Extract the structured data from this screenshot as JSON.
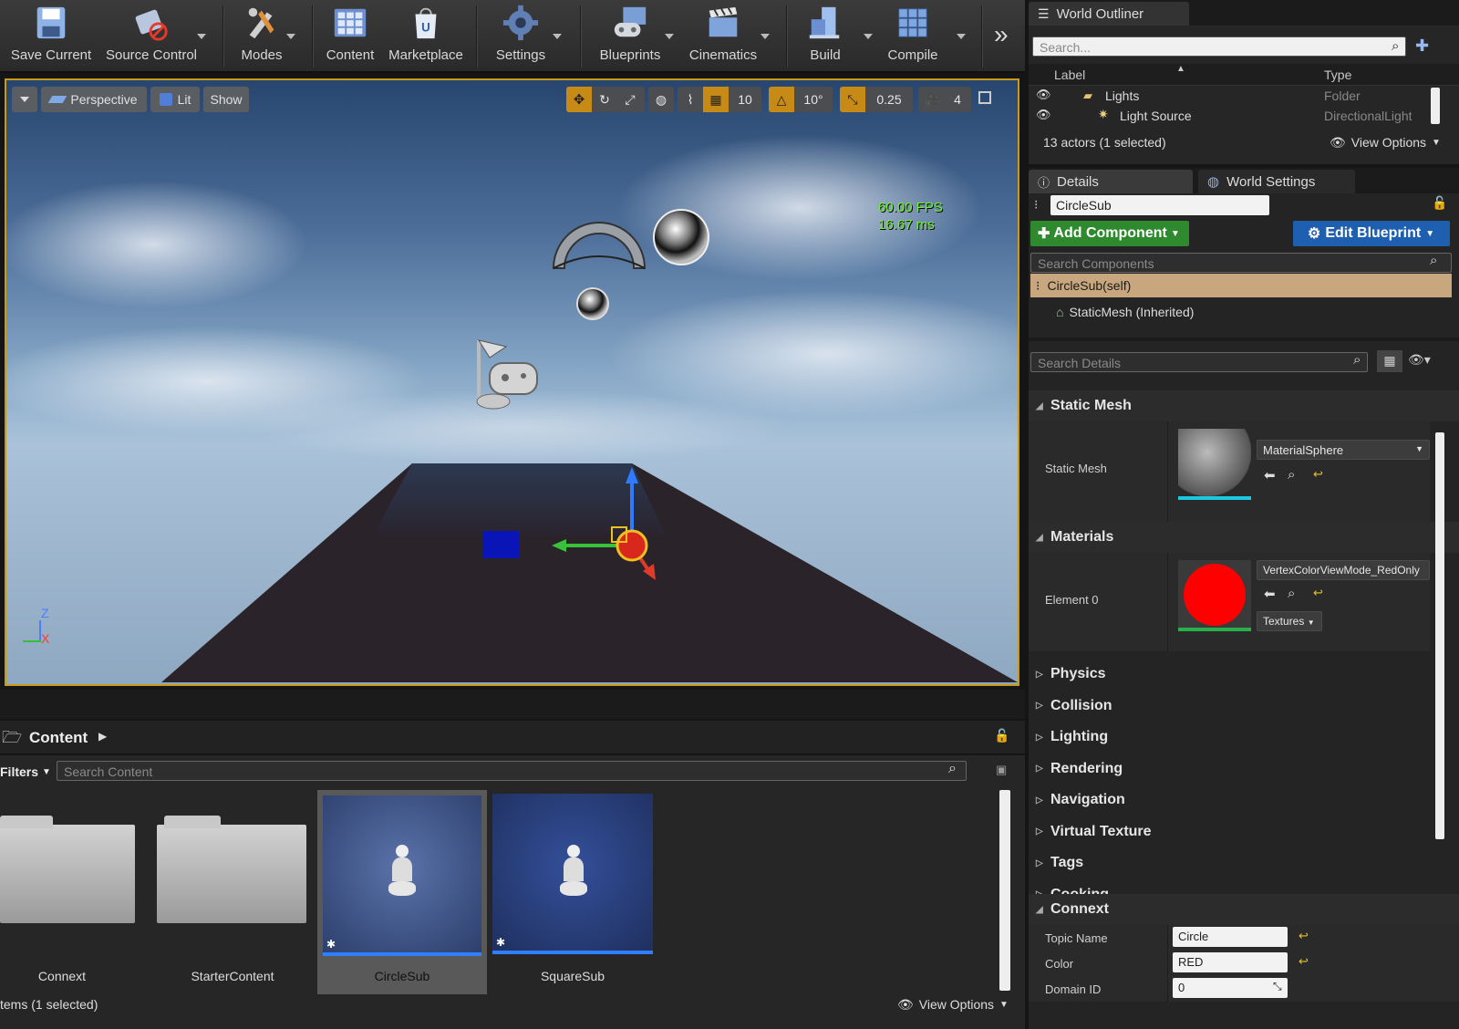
{
  "toolbar": {
    "items": [
      {
        "label": "Save Current",
        "icon": "save-icon"
      },
      {
        "label": "Source Control",
        "icon": "source-control-icon"
      },
      {
        "label": "Modes",
        "icon": "modes-icon"
      },
      {
        "label": "Content",
        "icon": "content-icon"
      },
      {
        "label": "Marketplace",
        "icon": "marketplace-icon"
      },
      {
        "label": "Settings",
        "icon": "settings-icon"
      },
      {
        "label": "Blueprints",
        "icon": "blueprints-icon"
      },
      {
        "label": "Cinematics",
        "icon": "cinematics-icon"
      },
      {
        "label": "Build",
        "icon": "build-icon"
      },
      {
        "label": "Compile",
        "icon": "compile-icon"
      }
    ],
    "overflow": "»"
  },
  "viewport": {
    "perspective": "Perspective",
    "lit": "Lit",
    "show": "Show",
    "grid_snap": "10",
    "rot_snap": "10°",
    "scale_snap": "0.25",
    "cam_speed": "4",
    "fps": "60.00 FPS",
    "ms": "16.67 ms",
    "axis_z": "Z",
    "axis_x": "X"
  },
  "outliner": {
    "tab": "World Outliner",
    "search_placeholder": "Search...",
    "col_label": "Label",
    "col_type": "Type",
    "rows": [
      {
        "label": "Lights",
        "type": "Folder"
      },
      {
        "label": "Light Source",
        "type": "DirectionalLight"
      }
    ],
    "status": "13 actors (1 selected)",
    "view_options": "View Options"
  },
  "details": {
    "tab_details": "Details",
    "tab_world": "World Settings",
    "actor_name": "CircleSub",
    "add_component": "Add Component",
    "edit_blueprint": "Edit Blueprint",
    "search_components": "Search Components",
    "components": [
      {
        "label": "CircleSub(self)"
      },
      {
        "label": "StaticMesh (Inherited)"
      }
    ],
    "search_details": "Search Details",
    "static_mesh_cat": "Static Mesh",
    "static_mesh_label": "Static Mesh",
    "static_mesh_value": "MaterialSphere",
    "materials_cat": "Materials",
    "element0_label": "Element 0",
    "element0_value": "VertexColorViewMode_RedOnly",
    "textures": "Textures",
    "categories": [
      "Physics",
      "Collision",
      "Lighting",
      "Rendering",
      "Navigation",
      "Virtual Texture",
      "Tags",
      "Cooking"
    ],
    "connext_cat": "Connext",
    "topic_label": "Topic Name",
    "topic_value": "Circle",
    "color_label": "Color",
    "color_value": "RED",
    "domain_label": "Domain ID",
    "domain_value": "0"
  },
  "content": {
    "title": "Content",
    "filters": "Filters",
    "search_placeholder": "Search Content",
    "assets": [
      {
        "label": "Connext",
        "kind": "folder"
      },
      {
        "label": "StarterContent",
        "kind": "folder"
      },
      {
        "label": "CircleSub",
        "kind": "blueprint",
        "selected": true
      },
      {
        "label": "SquareSub",
        "kind": "blueprint",
        "selected": false
      }
    ],
    "status": "tems (1 selected)",
    "view_options": "View Options"
  },
  "colors": {
    "accent": "#c89a17",
    "green": "#2f8a2f",
    "blue": "#1f5fb0",
    "selection": "#c8a77e",
    "fps": "#7cff3a"
  }
}
